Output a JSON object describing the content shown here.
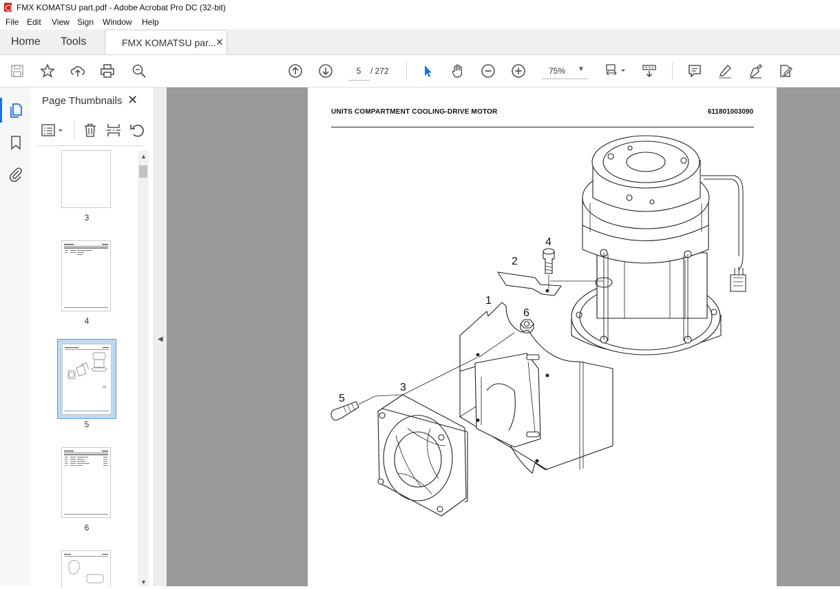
{
  "window": {
    "title": "FMX KOMATSU part.pdf - Adobe Acrobat Pro DC (32-bit)"
  },
  "menu": [
    "File",
    "Edit",
    "View",
    "Sign",
    "Window",
    "Help"
  ],
  "tabs": {
    "home": "Home",
    "tools": "Tools",
    "document": "FMX KOMATSU par...",
    "close": "✕"
  },
  "toolbar": {
    "page_current": "5",
    "page_total": "/ 272",
    "zoom": "75%"
  },
  "thumbnails": {
    "title": "Page Thumbnails",
    "pages": [
      {
        "label": "3"
      },
      {
        "label": "4"
      },
      {
        "label": "5"
      },
      {
        "label": "6"
      }
    ],
    "selected": "5"
  },
  "document": {
    "header_title": "UNITS COMPARTMENT COOLING-DRIVE MOTOR",
    "header_number": "611801003090",
    "callouts": [
      "1",
      "2",
      "3",
      "4",
      "5",
      "6"
    ]
  },
  "colors": {
    "accent": "#1473e6",
    "acrobat_red": "#d8241c",
    "selection": "#bfd9f1"
  }
}
